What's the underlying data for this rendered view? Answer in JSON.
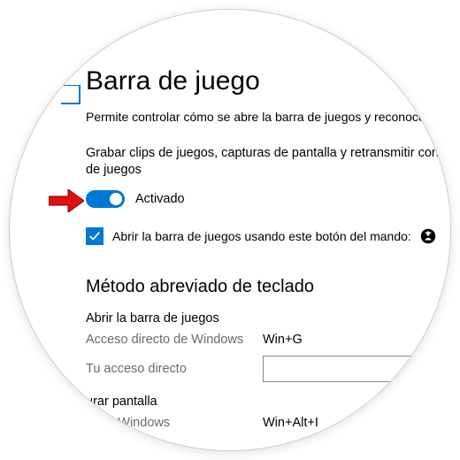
{
  "header": {
    "title": "Barra de juego",
    "description": "Permite controlar cómo se abre la barra de juegos y reconoce e"
  },
  "record": {
    "description": "Grabar clips de juegos, capturas de pantalla y retransmitir con la b\nde juegos",
    "toggle_state": "Activado",
    "checkbox_label": "Abrir la barra de juegos usando este botón del mando:"
  },
  "shortcuts": {
    "heading": "Método abreviado de teclado",
    "open_bar_label": "Abrir la barra de juegos",
    "row1_key": "Acceso directo de Windows",
    "row1_val": "Win+G",
    "row2_key": "Tu acceso directo",
    "row2_val": "",
    "cap_label": "urar pantalla",
    "cap_key": "to de Windows",
    "cap_val": "Win+Alt+I"
  }
}
